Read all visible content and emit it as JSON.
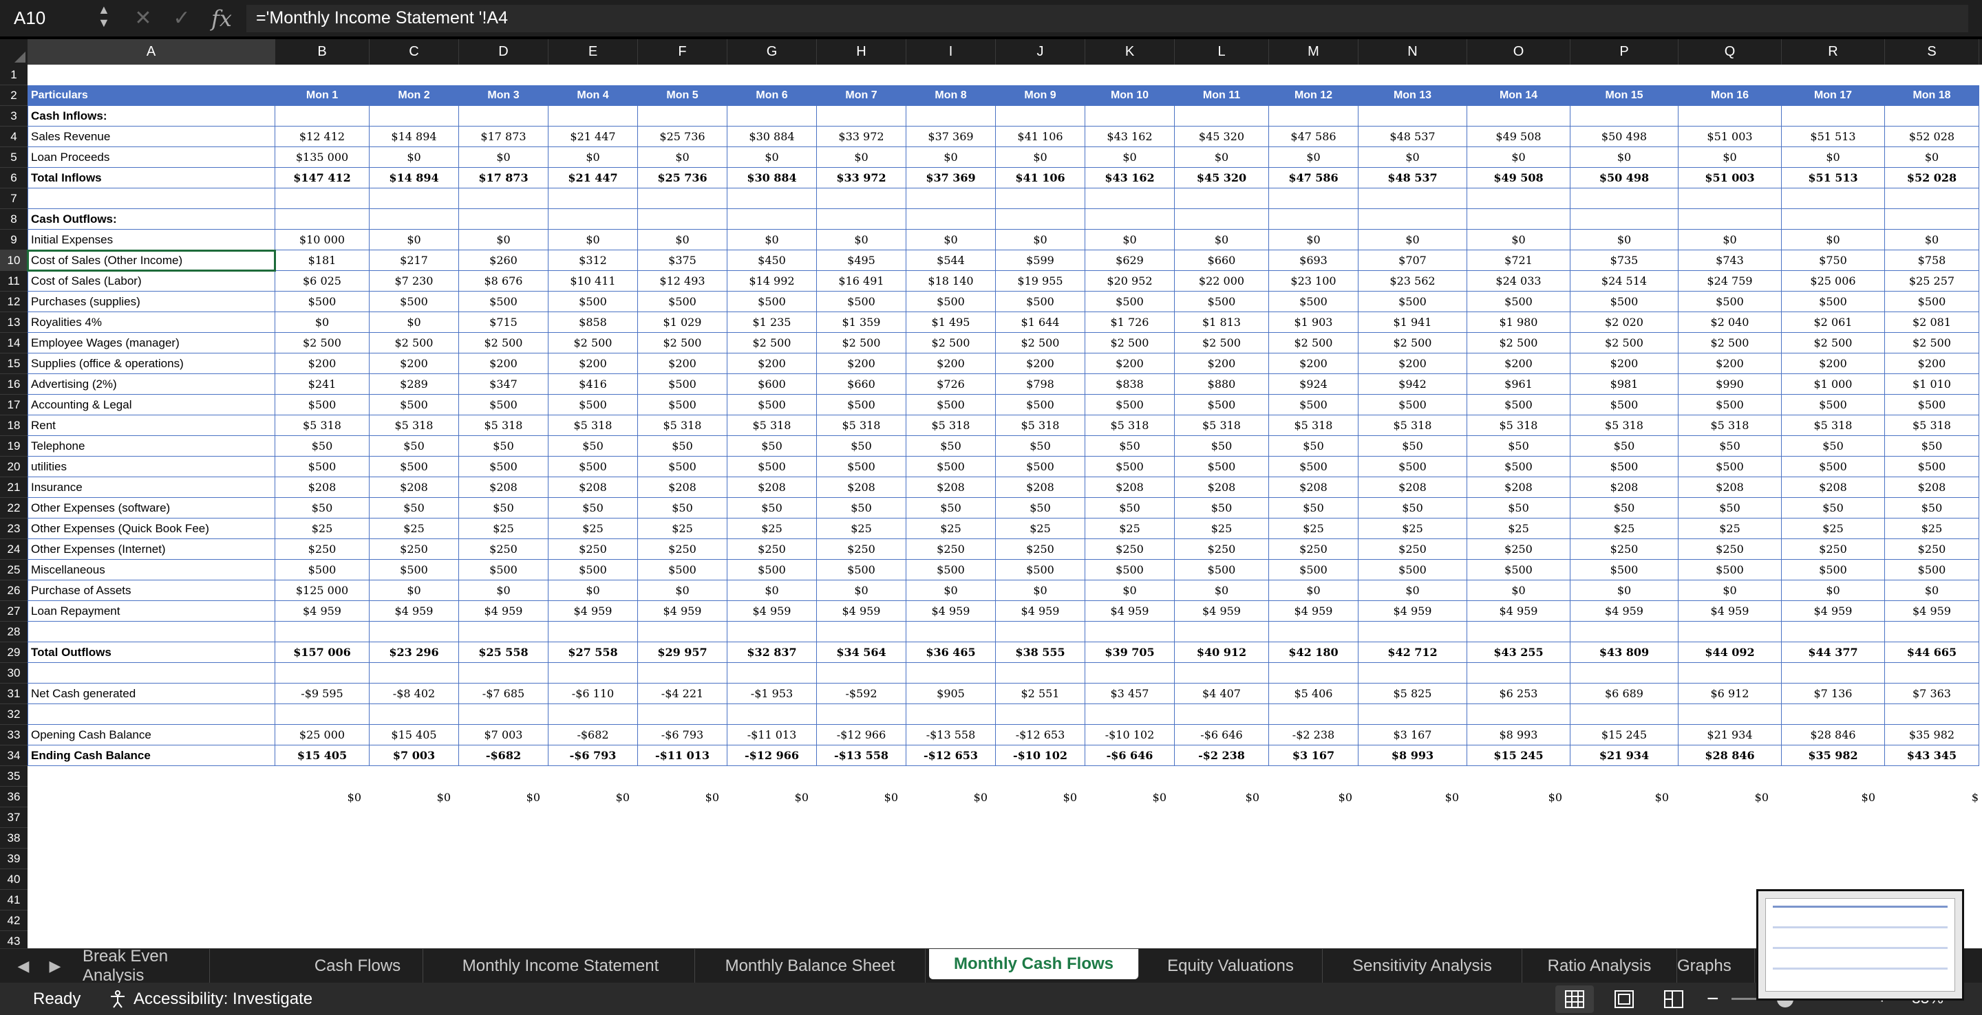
{
  "formula_bar": {
    "name_box": "A10",
    "formula": "='Monthly Income Statement '!A4",
    "fx_label": "fx"
  },
  "columns": [
    "A",
    "B",
    "C",
    "D",
    "E",
    "F",
    "G",
    "H",
    "I",
    "J",
    "K",
    "L",
    "M",
    "N",
    "O",
    "P",
    "Q",
    "R",
    "S"
  ],
  "selected_column": "A",
  "selected_row": 10,
  "header_row": [
    "Particulars",
    "Mon 1",
    "Mon 2",
    "Mon 3",
    "Mon 4",
    "Mon 5",
    "Mon 6",
    "Mon 7",
    "Mon 8",
    "Mon 9",
    "Mon 10",
    "Mon 11",
    "Mon 12",
    "Mon 13",
    "Mon 14",
    "Mon 15",
    "Mon 16",
    "Mon 17",
    "Mon 18"
  ],
  "rows": [
    {
      "n": 1,
      "cells": []
    },
    {
      "n": 2,
      "style": "hdr",
      "cells": [
        "Particulars",
        "Mon 1",
        "Mon 2",
        "Mon 3",
        "Mon 4",
        "Mon 5",
        "Mon 6",
        "Mon 7",
        "Mon 8",
        "Mon 9",
        "Mon 10",
        "Mon 11",
        "Mon 12",
        "Mon 13",
        "Mon 14",
        "Mon 15",
        "Mon 16",
        "Mon 17",
        "Mon 18"
      ]
    },
    {
      "n": 3,
      "style": "bold",
      "cells": [
        "Cash Inflows:"
      ]
    },
    {
      "n": 4,
      "cells": [
        "Sales Revenue",
        "$12 412",
        "$14 894",
        "$17 873",
        "$21 447",
        "$25 736",
        "$30 884",
        "$33 972",
        "$37 369",
        "$41 106",
        "$43 162",
        "$45 320",
        "$47 586",
        "$48 537",
        "$49 508",
        "$50 498",
        "$51 003",
        "$51 513",
        "$52 028"
      ]
    },
    {
      "n": 5,
      "cells": [
        "Loan Proceeds",
        "$135 000",
        "$0",
        "$0",
        "$0",
        "$0",
        "$0",
        "$0",
        "$0",
        "$0",
        "$0",
        "$0",
        "$0",
        "$0",
        "$0",
        "$0",
        "$0",
        "$0",
        "$0"
      ]
    },
    {
      "n": 6,
      "style": "bold",
      "cells": [
        "Total Inflows",
        "$147 412",
        "$14 894",
        "$17 873",
        "$21 447",
        "$25 736",
        "$30 884",
        "$33 972",
        "$37 369",
        "$41 106",
        "$43 162",
        "$45 320",
        "$47 586",
        "$48 537",
        "$49 508",
        "$50 498",
        "$51 003",
        "$51 513",
        "$52 028"
      ]
    },
    {
      "n": 7,
      "cells": []
    },
    {
      "n": 8,
      "style": "bold",
      "cells": [
        "Cash Outflows:"
      ]
    },
    {
      "n": 9,
      "cells": [
        "Initial Expenses",
        "$10 000",
        "$0",
        "$0",
        "$0",
        "$0",
        "$0",
        "$0",
        "$0",
        "$0",
        "$0",
        "$0",
        "$0",
        "$0",
        "$0",
        "$0",
        "$0",
        "$0",
        "$0"
      ]
    },
    {
      "n": 10,
      "cells": [
        "Cost of Sales (Other Income)",
        "$181",
        "$217",
        "$260",
        "$312",
        "$375",
        "$450",
        "$495",
        "$544",
        "$599",
        "$629",
        "$660",
        "$693",
        "$707",
        "$721",
        "$735",
        "$743",
        "$750",
        "$758"
      ]
    },
    {
      "n": 11,
      "cells": [
        "Cost of Sales (Labor)",
        "$6 025",
        "$7 230",
        "$8 676",
        "$10 411",
        "$12 493",
        "$14 992",
        "$16 491",
        "$18 140",
        "$19 955",
        "$20 952",
        "$22 000",
        "$23 100",
        "$23 562",
        "$24 033",
        "$24 514",
        "$24 759",
        "$25 006",
        "$25 257"
      ]
    },
    {
      "n": 12,
      "cells": [
        "Purchases (supplies)",
        "$500",
        "$500",
        "$500",
        "$500",
        "$500",
        "$500",
        "$500",
        "$500",
        "$500",
        "$500",
        "$500",
        "$500",
        "$500",
        "$500",
        "$500",
        "$500",
        "$500",
        "$500"
      ]
    },
    {
      "n": 13,
      "cells": [
        "Royalities 4%",
        "$0",
        "$0",
        "$715",
        "$858",
        "$1 029",
        "$1 235",
        "$1 359",
        "$1 495",
        "$1 644",
        "$1 726",
        "$1 813",
        "$1 903",
        "$1 941",
        "$1 980",
        "$2 020",
        "$2 040",
        "$2 061",
        "$2 081"
      ]
    },
    {
      "n": 14,
      "cells": [
        "Employee Wages (manager)",
        "$2 500",
        "$2 500",
        "$2 500",
        "$2 500",
        "$2 500",
        "$2 500",
        "$2 500",
        "$2 500",
        "$2 500",
        "$2 500",
        "$2 500",
        "$2 500",
        "$2 500",
        "$2 500",
        "$2 500",
        "$2 500",
        "$2 500",
        "$2 500"
      ]
    },
    {
      "n": 15,
      "cells": [
        "Supplies (office & operations)",
        "$200",
        "$200",
        "$200",
        "$200",
        "$200",
        "$200",
        "$200",
        "$200",
        "$200",
        "$200",
        "$200",
        "$200",
        "$200",
        "$200",
        "$200",
        "$200",
        "$200",
        "$200"
      ]
    },
    {
      "n": 16,
      "cells": [
        "Advertising (2%)",
        "$241",
        "$289",
        "$347",
        "$416",
        "$500",
        "$600",
        "$660",
        "$726",
        "$798",
        "$838",
        "$880",
        "$924",
        "$942",
        "$961",
        "$981",
        "$990",
        "$1 000",
        "$1 010"
      ]
    },
    {
      "n": 17,
      "cells": [
        "Accounting & Legal",
        "$500",
        "$500",
        "$500",
        "$500",
        "$500",
        "$500",
        "$500",
        "$500",
        "$500",
        "$500",
        "$500",
        "$500",
        "$500",
        "$500",
        "$500",
        "$500",
        "$500",
        "$500"
      ]
    },
    {
      "n": 18,
      "cells": [
        "Rent",
        "$5 318",
        "$5 318",
        "$5 318",
        "$5 318",
        "$5 318",
        "$5 318",
        "$5 318",
        "$5 318",
        "$5 318",
        "$5 318",
        "$5 318",
        "$5 318",
        "$5 318",
        "$5 318",
        "$5 318",
        "$5 318",
        "$5 318",
        "$5 318"
      ]
    },
    {
      "n": 19,
      "cells": [
        "Telephone",
        "$50",
        "$50",
        "$50",
        "$50",
        "$50",
        "$50",
        "$50",
        "$50",
        "$50",
        "$50",
        "$50",
        "$50",
        "$50",
        "$50",
        "$50",
        "$50",
        "$50",
        "$50"
      ]
    },
    {
      "n": 20,
      "cells": [
        "utilities",
        "$500",
        "$500",
        "$500",
        "$500",
        "$500",
        "$500",
        "$500",
        "$500",
        "$500",
        "$500",
        "$500",
        "$500",
        "$500",
        "$500",
        "$500",
        "$500",
        "$500",
        "$500"
      ]
    },
    {
      "n": 21,
      "cells": [
        "Insurance",
        "$208",
        "$208",
        "$208",
        "$208",
        "$208",
        "$208",
        "$208",
        "$208",
        "$208",
        "$208",
        "$208",
        "$208",
        "$208",
        "$208",
        "$208",
        "$208",
        "$208",
        "$208"
      ]
    },
    {
      "n": 22,
      "cells": [
        "Other Expenses (software)",
        "$50",
        "$50",
        "$50",
        "$50",
        "$50",
        "$50",
        "$50",
        "$50",
        "$50",
        "$50",
        "$50",
        "$50",
        "$50",
        "$50",
        "$50",
        "$50",
        "$50",
        "$50"
      ]
    },
    {
      "n": 23,
      "cells": [
        "Other Expenses (Quick Book Fee)",
        "$25",
        "$25",
        "$25",
        "$25",
        "$25",
        "$25",
        "$25",
        "$25",
        "$25",
        "$25",
        "$25",
        "$25",
        "$25",
        "$25",
        "$25",
        "$25",
        "$25",
        "$25"
      ]
    },
    {
      "n": 24,
      "cells": [
        "Other Expenses (Internet)",
        "$250",
        "$250",
        "$250",
        "$250",
        "$250",
        "$250",
        "$250",
        "$250",
        "$250",
        "$250",
        "$250",
        "$250",
        "$250",
        "$250",
        "$250",
        "$250",
        "$250",
        "$250"
      ]
    },
    {
      "n": 25,
      "cells": [
        "Miscellaneous",
        "$500",
        "$500",
        "$500",
        "$500",
        "$500",
        "$500",
        "$500",
        "$500",
        "$500",
        "$500",
        "$500",
        "$500",
        "$500",
        "$500",
        "$500",
        "$500",
        "$500",
        "$500"
      ]
    },
    {
      "n": 26,
      "cells": [
        "Purchase of Assets",
        "$125 000",
        "$0",
        "$0",
        "$0",
        "$0",
        "$0",
        "$0",
        "$0",
        "$0",
        "$0",
        "$0",
        "$0",
        "$0",
        "$0",
        "$0",
        "$0",
        "$0",
        "$0"
      ]
    },
    {
      "n": 27,
      "cells": [
        "Loan Repayment",
        "$4 959",
        "$4 959",
        "$4 959",
        "$4 959",
        "$4 959",
        "$4 959",
        "$4 959",
        "$4 959",
        "$4 959",
        "$4 959",
        "$4 959",
        "$4 959",
        "$4 959",
        "$4 959",
        "$4 959",
        "$4 959",
        "$4 959",
        "$4 959"
      ]
    },
    {
      "n": 28,
      "cells": []
    },
    {
      "n": 29,
      "style": "bold",
      "cells": [
        "Total Outflows",
        "$157 006",
        "$23 296",
        "$25 558",
        "$27 558",
        "$29 957",
        "$32 837",
        "$34 564",
        "$36 465",
        "$38 555",
        "$39 705",
        "$40 912",
        "$42 180",
        "$42 712",
        "$43 255",
        "$43 809",
        "$44 092",
        "$44 377",
        "$44 665"
      ]
    },
    {
      "n": 30,
      "cells": []
    },
    {
      "n": 31,
      "cells": [
        "Net Cash generated",
        "-$9 595",
        "-$8 402",
        "-$7 685",
        "-$6 110",
        "-$4 221",
        "-$1 953",
        "-$592",
        "$905",
        "$2 551",
        "$3 457",
        "$4 407",
        "$5 406",
        "$5 825",
        "$6 253",
        "$6 689",
        "$6 912",
        "$7 136",
        "$7 363"
      ]
    },
    {
      "n": 32,
      "cells": []
    },
    {
      "n": 33,
      "cells": [
        "Opening Cash Balance",
        "$25 000",
        "$15 405",
        "$7 003",
        "-$682",
        "-$6 793",
        "-$11 013",
        "-$12 966",
        "-$13 558",
        "-$12 653",
        "-$10 102",
        "-$6 646",
        "-$2 238",
        "$3 167",
        "$8 993",
        "$15 245",
        "$21 934",
        "$28 846",
        "$35 982"
      ]
    },
    {
      "n": 34,
      "style": "bold",
      "cells": [
        "Ending Cash Balance",
        "$15 405",
        "$7 003",
        "-$682",
        "-$6 793",
        "-$11 013",
        "-$12 966",
        "-$13 558",
        "-$12 653",
        "-$10 102",
        "-$6 646",
        "-$2 238",
        "$3 167",
        "$8 993",
        "$15 245",
        "$21 934",
        "$28 846",
        "$35 982",
        "$43 345"
      ]
    },
    {
      "n": 35,
      "cells": []
    },
    {
      "n": 36,
      "style": "zeros",
      "cells": [
        "",
        "$0",
        "$0",
        "$0",
        "$0",
        "$0",
        "$0",
        "$0",
        "$0",
        "$0",
        "$0",
        "$0",
        "$0",
        "$0",
        "$0",
        "$0",
        "$0",
        "$0",
        "$"
      ]
    },
    {
      "n": 37,
      "cells": []
    },
    {
      "n": 38,
      "cells": []
    },
    {
      "n": 39,
      "cells": []
    },
    {
      "n": 40,
      "cells": []
    },
    {
      "n": 41,
      "cells": []
    },
    {
      "n": 42,
      "cells": []
    },
    {
      "n": 43,
      "cells": []
    }
  ],
  "sheet_tabs": [
    "Break Even Analysis",
    "Cash Flows",
    "Monthly Income Statement",
    "Monthly Balance Sheet",
    "Monthly Cash Flows",
    "Equity Valuations",
    "Sensitivity Analysis",
    "Ratio Analysis",
    "Graphs"
  ],
  "active_tab": "Monthly Cash Flows",
  "status": {
    "ready": "Ready",
    "accessibility": "Accessibility: Investigate",
    "zoom": "85%"
  },
  "colors": {
    "header_blue": "#4a72c4",
    "active_tab_text": "#1d7a46",
    "selection": "#1d6b3a"
  }
}
